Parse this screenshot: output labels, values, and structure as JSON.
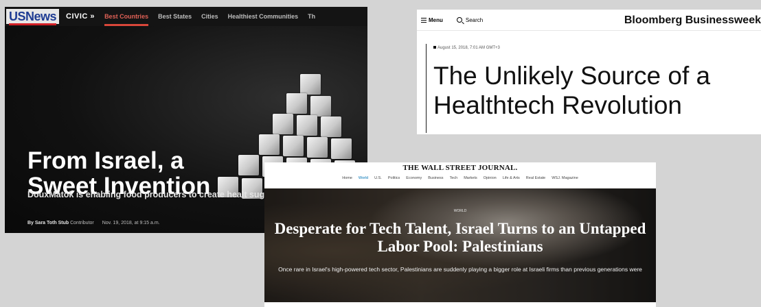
{
  "usnews": {
    "logo": "USNews",
    "civic": "CIVIC",
    "nav": [
      "Best Countries",
      "Best States",
      "Cities",
      "Healthiest Communities",
      "Th"
    ],
    "active_nav_index": 0,
    "title_line1": "From Israel, a",
    "title_line2": "Sweet Invention",
    "subtitle": "DouxMatok is enabling food producers to create healt sugar 'stronger.'",
    "byline_author": "By Sara Toth Stub",
    "byline_role": "Contributor",
    "byline_date": "Nov. 19, 2018, at 9:15 a.m."
  },
  "bloomberg": {
    "menu_label": "Menu",
    "search_label": "Search",
    "brand": "Bloomberg Businessweek",
    "date": "August 15, 2018, 7:01 AM GMT+3",
    "headline": "The Unlikely Source of a Healthtech Revolution"
  },
  "wsj": {
    "masthead": "THE WALL STREET JOURNAL.",
    "nav": [
      "Home",
      "World",
      "U.S.",
      "Politics",
      "Economy",
      "Business",
      "Tech",
      "Markets",
      "Opinion",
      "Life & Arts",
      "Real Estate",
      "WSJ. Magazine"
    ],
    "active_nav_index": 1,
    "kicker": "WORLD",
    "title": "Desperate for Tech Talent, Israel Turns to an Untapped Labor Pool: Palestinians",
    "subtitle": "Once rare in Israel's high-powered tech sector, Palestinians are suddenly playing a bigger role at Israeli firms than previous generations were"
  },
  "colors": {
    "usnews_logo_blue": "#1f3c93",
    "usnews_accent_red": "#d9473a",
    "wsj_link_blue": "#0274b6"
  }
}
